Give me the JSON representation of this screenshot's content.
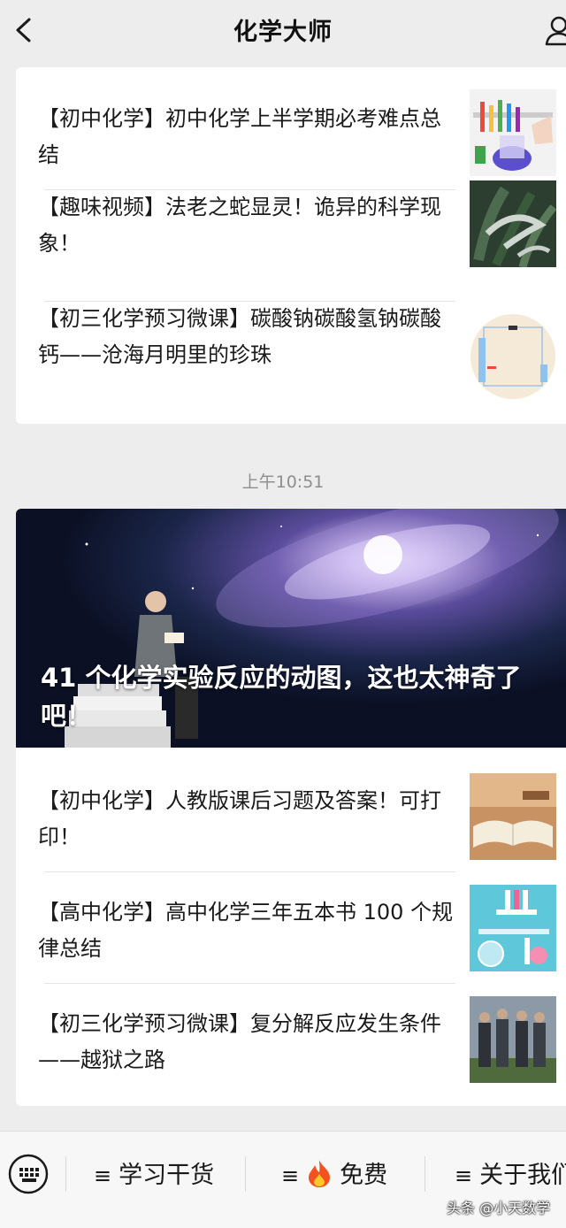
{
  "header": {
    "title": "化学大师",
    "back_icon": "chevron-left-icon",
    "profile_icon": "person-icon"
  },
  "cards": [
    {
      "items": [
        {
          "title": "【初中化学】初中化学上半学期必考难点总结",
          "thumb_icon": "lab-test-tubes-thumbnail"
        },
        {
          "title": "【趣味视频】法老之蛇显灵！诡异的科学现象！",
          "thumb_icon": "pharaoh-serpent-thumbnail"
        },
        {
          "title": "【初三化学预习微课】碳酸钠碳酸氢钠碳酸钙——沧海月明里的珍珠",
          "thumb_icon": "beaker-diagram-thumbnail"
        }
      ]
    },
    {
      "hero": {
        "title": "41 个化学实验反应的动图，这也太神奇了吧！",
        "image": "galaxy-with-reader-image"
      },
      "items": [
        {
          "title": "【初中化学】人教版课后习题及答案！可打印！",
          "thumb_icon": "open-book-thumbnail"
        },
        {
          "title": "【高中化学】高中化学三年五本书 100 个规律总结",
          "thumb_icon": "lab-equipment-illustration-thumbnail"
        },
        {
          "title": "【初三化学预习微课】复分解反应发生条件——越狱之路",
          "thumb_icon": "prison-scene-thumbnail"
        }
      ]
    }
  ],
  "timestamp": "上午10:51",
  "menu": {
    "keyboard_icon": "keyboard-icon",
    "items": [
      {
        "glyph": "≡",
        "label": "学习干货"
      },
      {
        "glyph": "≡",
        "emoji": "🔥",
        "label": "免费"
      },
      {
        "glyph": "≡",
        "label": "关于我们"
      }
    ]
  },
  "watermark": "头条 @小天数学"
}
